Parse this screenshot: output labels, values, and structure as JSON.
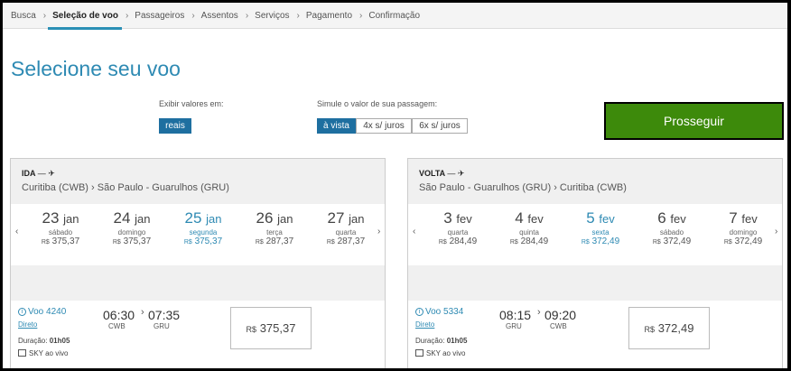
{
  "breadcrumb": [
    "Busca",
    "Seleção de voo",
    "Passageiros",
    "Assentos",
    "Serviços",
    "Pagamento",
    "Confirmação"
  ],
  "page_title": "Selecione seu voo",
  "currency": {
    "label": "Exibir valores em:",
    "option": "reais"
  },
  "payment": {
    "label": "Simule o valor de sua passagem:",
    "options": [
      "à vista",
      "4x s/ juros",
      "6x s/ juros"
    ]
  },
  "continue_label": "Prosseguir",
  "colors": {
    "accent": "#2e8ab3",
    "continue": "#3d8a0b",
    "selected_pill": "#1e6fa0"
  },
  "ida": {
    "direction": "IDA",
    "route_from": "Curitiba (CWB)",
    "route_to": "São Paulo - Guarulhos (GRU)",
    "days": [
      {
        "num": "23",
        "mon": "jan",
        "weekday": "sábado",
        "cur": "R$",
        "price": "375,37"
      },
      {
        "num": "24",
        "mon": "jan",
        "weekday": "domingo",
        "cur": "R$",
        "price": "375,37"
      },
      {
        "num": "25",
        "mon": "jan",
        "weekday": "segunda",
        "cur": "R$",
        "price": "375,37"
      },
      {
        "num": "26",
        "mon": "jan",
        "weekday": "terça",
        "cur": "R$",
        "price": "287,37"
      },
      {
        "num": "27",
        "mon": "jan",
        "weekday": "quarta",
        "cur": "R$",
        "price": "287,37"
      }
    ],
    "flight": {
      "number": "Voo 4240",
      "direto": "Direto",
      "dep_time": "06:30",
      "arr_time": "07:35",
      "dep_code": "CWB",
      "arr_code": "GRU",
      "duration_label": "Duração:",
      "duration": "01h05",
      "amenity": "SKY ao vivo",
      "cur": "R$",
      "price": "375,37"
    }
  },
  "volta": {
    "direction": "VOLTA",
    "route_from": "São Paulo - Guarulhos (GRU)",
    "route_to": "Curitiba (CWB)",
    "days": [
      {
        "num": "3",
        "mon": "fev",
        "weekday": "quarta",
        "cur": "R$",
        "price": "284,49"
      },
      {
        "num": "4",
        "mon": "fev",
        "weekday": "quinta",
        "cur": "R$",
        "price": "284,49"
      },
      {
        "num": "5",
        "mon": "fev",
        "weekday": "sexta",
        "cur": "R$",
        "price": "372,49"
      },
      {
        "num": "6",
        "mon": "fev",
        "weekday": "sábado",
        "cur": "R$",
        "price": "372,49"
      },
      {
        "num": "7",
        "mon": "fev",
        "weekday": "domingo",
        "cur": "R$",
        "price": "372,49"
      }
    ],
    "flight": {
      "number": "Voo 5334",
      "direto": "Direto",
      "dep_time": "08:15",
      "arr_time": "09:20",
      "dep_code": "GRU",
      "arr_code": "CWB",
      "duration_label": "Duração:",
      "duration": "01h05",
      "amenity": "SKY ao vivo",
      "cur": "R$",
      "price": "372,49"
    }
  }
}
